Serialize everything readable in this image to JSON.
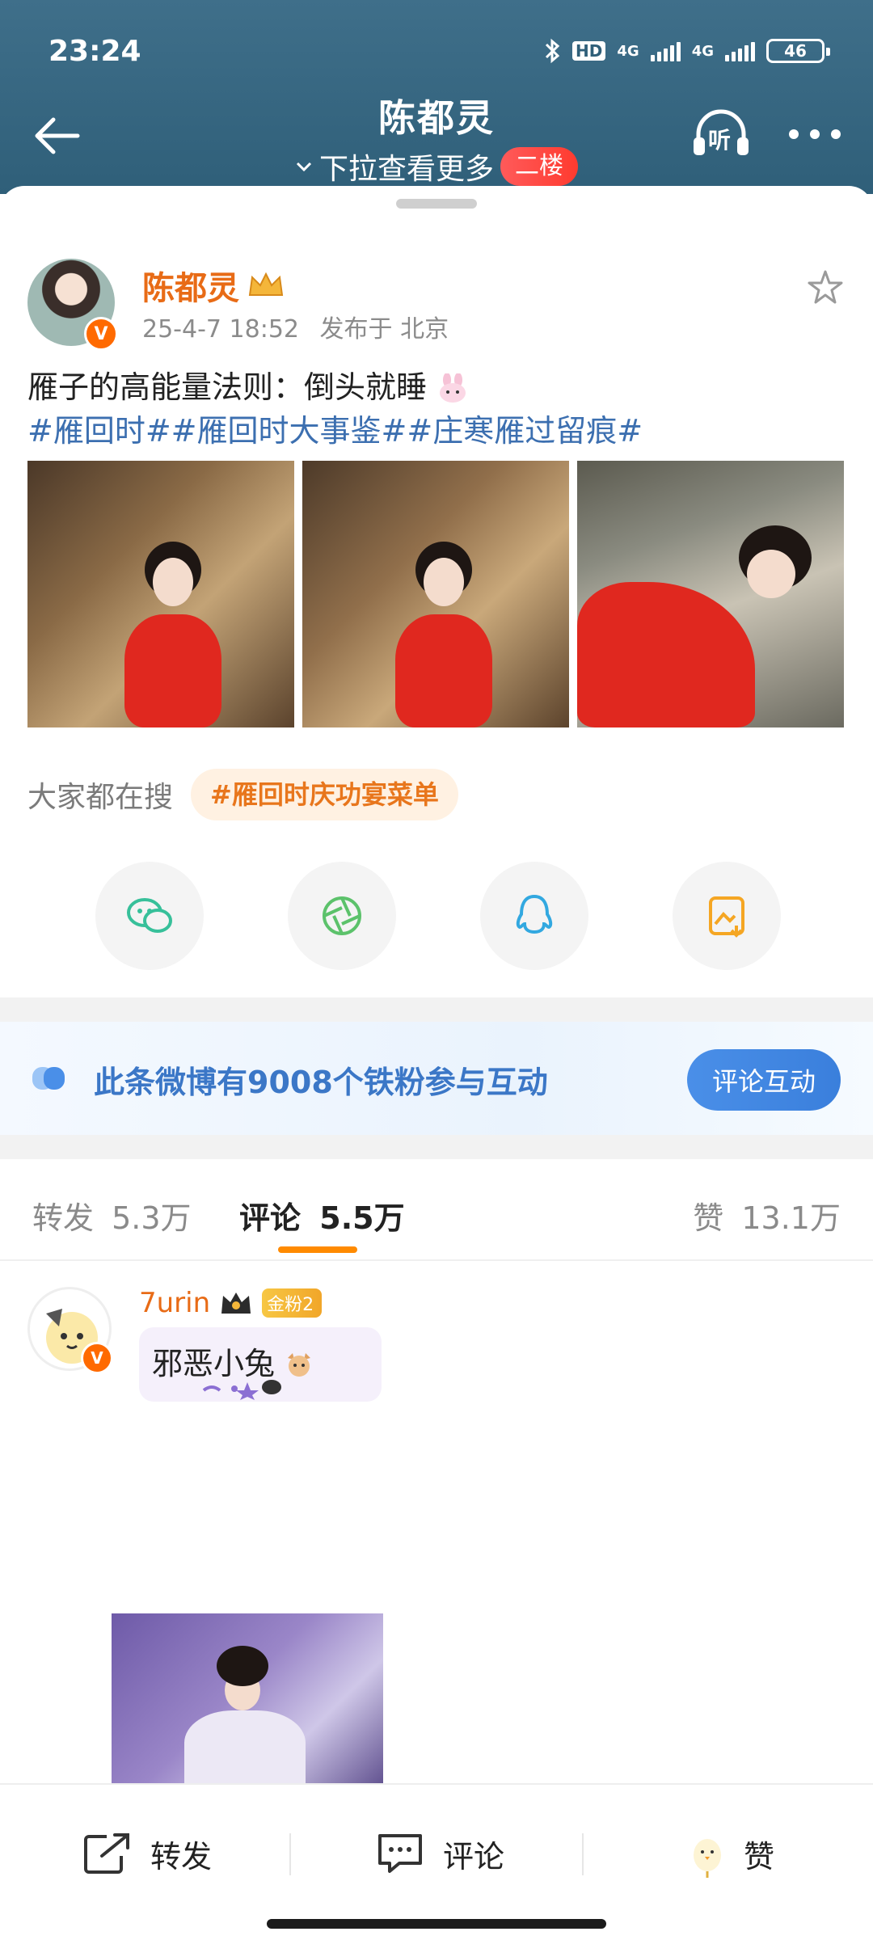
{
  "status_bar": {
    "time": "23:24",
    "network_1": "4G",
    "network_2": "4G",
    "battery": "46",
    "hd": "HD"
  },
  "header": {
    "title": "陈都灵",
    "subtitle": "下拉查看更多",
    "floor_badge": "二楼",
    "listen_label": "听"
  },
  "post": {
    "author": "陈都灵",
    "verified": "V",
    "time": "25-4-7 18:52",
    "location": "发布于 北京",
    "text": "雁子的高能量法则：倒头就睡",
    "tags": "#雁回时##雁回时大事鉴##庄寒雁过留痕#"
  },
  "search": {
    "label": "大家都在搜",
    "pill": "#雁回时庆功宴菜单"
  },
  "share": {
    "icons": [
      "wechat-icon",
      "moments-icon",
      "qq-icon",
      "save-image-icon"
    ]
  },
  "fans_card": {
    "text": "此条微博有9008个铁粉参与互动",
    "button": "评论互动"
  },
  "tabs": {
    "repost": {
      "label": "转发",
      "count": "5.3万"
    },
    "comment": {
      "label": "评论",
      "count": "5.5万"
    },
    "like": {
      "label": "赞",
      "count": "13.1万"
    }
  },
  "comment": {
    "author": "7urin",
    "verified": "V",
    "fan_badge": "金粉2",
    "text": "邪恶小兔"
  },
  "bottom_bar": {
    "repost": "转发",
    "comment": "评论",
    "like": "赞"
  },
  "colors": {
    "header": "#2f5f79",
    "accent_orange": "#e86b16",
    "link_blue": "#3c6fb0",
    "button_blue": "#3a7fdc"
  }
}
